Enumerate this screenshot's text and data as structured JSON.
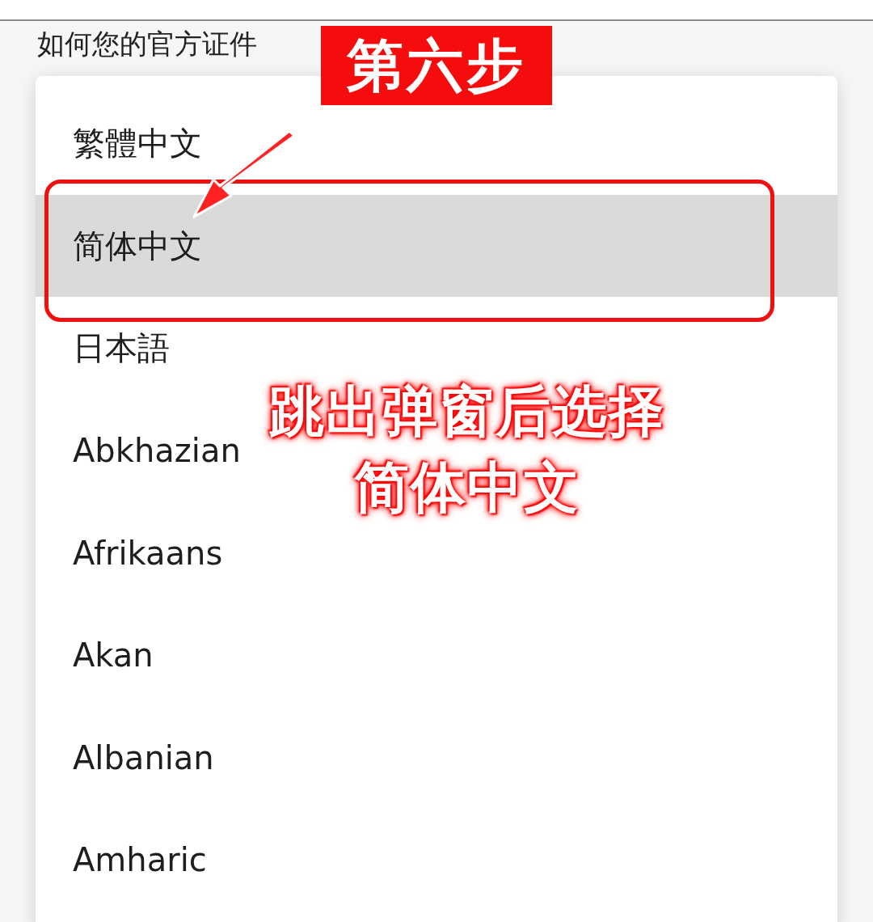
{
  "header": {
    "title": "如何您的官方证件"
  },
  "language_menu": {
    "items": [
      {
        "label": "繁體中文",
        "selected": false
      },
      {
        "label": "简体中文",
        "selected": true
      },
      {
        "label": "日本語",
        "selected": false
      },
      {
        "label": "Abkhazian",
        "selected": false
      },
      {
        "label": "Afrikaans",
        "selected": false
      },
      {
        "label": "Akan",
        "selected": false
      },
      {
        "label": "Albanian",
        "selected": false
      },
      {
        "label": "Amharic",
        "selected": false
      }
    ]
  },
  "annotation": {
    "step_label": "第六步",
    "callout_lines": [
      "跳出弹窗后选择",
      "简体中文"
    ]
  }
}
